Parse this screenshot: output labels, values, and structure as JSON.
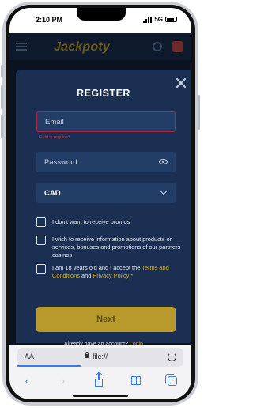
{
  "status_bar": {
    "time": "2:10 PM",
    "network": "5G"
  },
  "site": {
    "logo": "Jackpoty"
  },
  "modal": {
    "title": "REGISTER",
    "email_placeholder": "Email",
    "email_error": "Field is required",
    "password_placeholder": "Password",
    "currency_value": "CAD",
    "checkboxes": [
      {
        "label": "I don't want to receive promos",
        "checked": false
      },
      {
        "label": "I wish to receive information about products or services, bonuses and promotions of our partners casinos",
        "checked": false
      },
      {
        "label_prefix": "I am 18 years old and I accept the ",
        "terms_link": "Terms and Conditions",
        "and": " and ",
        "privacy_link": "Privacy Policy",
        "required_mark": " *",
        "checked": false
      }
    ],
    "next_label": "Next",
    "already_text": "Already have an account?",
    "login_link": "Login"
  },
  "browser": {
    "text_size_label": "AA",
    "url": "file://",
    "load_progress": 0.38
  },
  "icons": [
    "hamburger-icon",
    "search-icon",
    "flag-icon",
    "close-icon",
    "eye-icon",
    "chevron-down-icon",
    "lock-icon",
    "reload-icon",
    "back-icon",
    "forward-icon",
    "share-icon",
    "bookmarks-icon",
    "tabs-icon"
  ],
  "colors": {
    "accent_gold": "#b79a2b",
    "link_gold": "#d4b12a",
    "error_red": "#c23a45",
    "modal_bg": "#1a2f52",
    "browser_blue": "#2f7cf6"
  }
}
